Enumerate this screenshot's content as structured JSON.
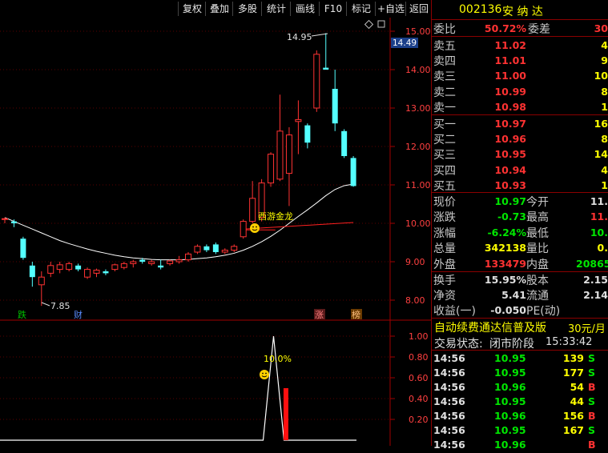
{
  "toolbar": {
    "items": [
      "复权",
      "叠加",
      "多股",
      "统计",
      "画线",
      "F10",
      "标记",
      "+自选",
      "返回"
    ]
  },
  "chart": {
    "price_ticks": [
      "15.00",
      "14.00",
      "13.00",
      "12.00",
      "11.00",
      "10.00",
      "9.00",
      "8.00"
    ],
    "current_price_tag": "14.49",
    "high_label": "14.95",
    "low_label": "7.85",
    "strategy_label": "西游金龙",
    "event_markers": [
      "跌",
      "财",
      "涨",
      "榜"
    ],
    "indicator_ticks": [
      "1.00",
      "0.80",
      "0.60",
      "0.40",
      "0.20"
    ],
    "indicator_label": "10.0%",
    "icons": [
      "smiley-icon",
      "diamond-icon"
    ]
  },
  "chart_data": {
    "type": "candlestick",
    "title": "",
    "ylim": [
      7.7,
      15.3
    ],
    "candles": [
      {
        "o": 10.1,
        "h": 10.15,
        "l": 10.0,
        "c": 10.12
      },
      {
        "o": 10.05,
        "h": 10.1,
        "l": 9.9,
        "c": 10.0
      },
      {
        "o": 9.6,
        "h": 9.65,
        "l": 9.05,
        "c": 9.1
      },
      {
        "o": 8.9,
        "h": 9.0,
        "l": 8.35,
        "c": 8.6
      },
      {
        "o": 8.4,
        "h": 8.75,
        "l": 7.85,
        "c": 8.6
      },
      {
        "o": 8.7,
        "h": 9.0,
        "l": 8.6,
        "c": 8.9
      },
      {
        "o": 8.8,
        "h": 9.0,
        "l": 8.7,
        "c": 8.92
      },
      {
        "o": 8.8,
        "h": 9.0,
        "l": 8.75,
        "c": 8.95
      },
      {
        "o": 8.9,
        "h": 8.95,
        "l": 8.75,
        "c": 8.8
      },
      {
        "o": 8.6,
        "h": 8.85,
        "l": 8.55,
        "c": 8.8
      },
      {
        "o": 8.7,
        "h": 8.82,
        "l": 8.6,
        "c": 8.78
      },
      {
        "o": 8.75,
        "h": 8.8,
        "l": 8.65,
        "c": 8.7
      },
      {
        "o": 8.8,
        "h": 8.95,
        "l": 8.75,
        "c": 8.92
      },
      {
        "o": 8.85,
        "h": 9.0,
        "l": 8.8,
        "c": 8.95
      },
      {
        "o": 8.95,
        "h": 9.05,
        "l": 8.85,
        "c": 9.0
      },
      {
        "o": 9.05,
        "h": 9.1,
        "l": 8.95,
        "c": 9.0
      },
      {
        "o": 8.95,
        "h": 9.05,
        "l": 8.9,
        "c": 9.0
      },
      {
        "o": 8.9,
        "h": 9.05,
        "l": 8.8,
        "c": 8.85
      },
      {
        "o": 8.95,
        "h": 9.05,
        "l": 8.9,
        "c": 9.02
      },
      {
        "o": 9.0,
        "h": 9.15,
        "l": 8.95,
        "c": 9.05
      },
      {
        "o": 9.05,
        "h": 9.25,
        "l": 9.0,
        "c": 9.2
      },
      {
        "o": 9.25,
        "h": 9.45,
        "l": 9.2,
        "c": 9.4
      },
      {
        "o": 9.4,
        "h": 9.45,
        "l": 9.25,
        "c": 9.3
      },
      {
        "o": 9.45,
        "h": 9.5,
        "l": 9.2,
        "c": 9.25
      },
      {
        "o": 9.25,
        "h": 9.35,
        "l": 9.2,
        "c": 9.3
      },
      {
        "o": 9.3,
        "h": 9.45,
        "l": 9.25,
        "c": 9.4
      },
      {
        "o": 9.65,
        "h": 10.1,
        "l": 9.6,
        "c": 10.05
      },
      {
        "o": 10.05,
        "h": 11.1,
        "l": 10.0,
        "c": 10.65
      },
      {
        "o": 10.15,
        "h": 11.15,
        "l": 10.05,
        "c": 11.05
      },
      {
        "o": 11.05,
        "h": 11.85,
        "l": 10.95,
        "c": 11.8
      },
      {
        "o": 11.15,
        "h": 13.35,
        "l": 11.1,
        "c": 12.4
      },
      {
        "o": 11.3,
        "h": 12.5,
        "l": 10.45,
        "c": 12.3
      },
      {
        "o": 12.65,
        "h": 13.2,
        "l": 11.8,
        "c": 12.7
      },
      {
        "o": 12.55,
        "h": 12.6,
        "l": 11.95,
        "c": 12.1
      },
      {
        "o": 13.0,
        "h": 14.5,
        "l": 12.9,
        "c": 14.4
      },
      {
        "o": 14.05,
        "h": 14.95,
        "l": 14.0,
        "c": 14.0
      },
      {
        "o": 13.5,
        "h": 14.0,
        "l": 12.4,
        "c": 12.6
      },
      {
        "o": 12.4,
        "h": 12.45,
        "l": 11.7,
        "c": 11.75
      },
      {
        "o": 11.7,
        "h": 11.75,
        "l": 10.95,
        "c": 10.97
      }
    ],
    "ma": [
      10.15,
      10.05,
      9.95,
      9.85,
      9.75,
      9.65,
      9.55,
      9.47,
      9.4,
      9.33,
      9.27,
      9.22,
      9.17,
      9.13,
      9.1,
      9.08,
      9.06,
      9.05,
      9.05,
      9.05,
      9.06,
      9.08,
      9.1,
      9.13,
      9.17,
      9.22,
      9.3,
      9.4,
      9.52,
      9.66,
      9.82,
      10.0,
      10.18,
      10.35,
      10.53,
      10.72,
      10.88,
      10.98,
      11.02
    ],
    "ref_line": [
      9.85,
      10.02
    ],
    "indicator_ylim": [
      0,
      1.1
    ],
    "indicator_spike": {
      "index": 30,
      "value": 1.0
    },
    "indicator_bar": {
      "index": 31,
      "value": 0.5
    }
  },
  "quote": {
    "code": "002136",
    "name": "安 纳 达",
    "weibi_label": "委比",
    "weibi_value": "50.72%",
    "weicha_label": "委差",
    "weicha_value": "30",
    "sell": [
      {
        "label": "卖五",
        "price": "11.02",
        "vol": "4"
      },
      {
        "label": "卖四",
        "price": "11.01",
        "vol": "9"
      },
      {
        "label": "卖三",
        "price": "11.00",
        "vol": "10"
      },
      {
        "label": "卖二",
        "price": "10.99",
        "vol": "8"
      },
      {
        "label": "卖一",
        "price": "10.98",
        "vol": "1"
      }
    ],
    "buy": [
      {
        "label": "买一",
        "price": "10.97",
        "vol": "16"
      },
      {
        "label": "买二",
        "price": "10.96",
        "vol": "8"
      },
      {
        "label": "买三",
        "price": "10.95",
        "vol": "14"
      },
      {
        "label": "买四",
        "price": "10.94",
        "vol": "4"
      },
      {
        "label": "买五",
        "price": "10.93",
        "vol": "1"
      }
    ],
    "stats": [
      {
        "l1": "现价",
        "v1": "10.97",
        "c1": "green",
        "l2": "今开",
        "v2": "11.",
        "c2": "white"
      },
      {
        "l1": "涨跌",
        "v1": "-0.73",
        "c1": "green",
        "l2": "最高",
        "v2": "11.",
        "c2": "red"
      },
      {
        "l1": "涨幅",
        "v1": "-6.24%",
        "c1": "green",
        "l2": "最低",
        "v2": "10.",
        "c2": "green"
      },
      {
        "l1": "总量",
        "v1": "342138",
        "c1": "yellow",
        "l2": "量比",
        "v2": "0.",
        "c2": "yellow"
      },
      {
        "l1": "外盘",
        "v1": "133479",
        "c1": "red",
        "l2": "内盘",
        "v2": "20865",
        "c2": "green"
      }
    ],
    "stats2": [
      {
        "l1": "换手",
        "v1": "15.95%",
        "c1": "white",
        "l2": "股本",
        "v2": "2.15",
        "c2": "white"
      },
      {
        "l1": "净资",
        "v1": "5.41",
        "c1": "white",
        "l2": "流通",
        "v2": "2.14",
        "c2": "white"
      },
      {
        "l1": "收益(一)",
        "v1": "-0.050",
        "c1": "white",
        "l2": "PE(动)",
        "v2": "",
        "c2": "white"
      }
    ],
    "ad_text": "自动续费通达信普及版",
    "ad_price": "30元/月",
    "status_label": "交易状态:",
    "status_value": "闭市阶段",
    "status_time": "15:33:42",
    "ticks": [
      {
        "time": "14:56",
        "price": "10.95",
        "vol": "139",
        "side": "S"
      },
      {
        "time": "14:56",
        "price": "10.95",
        "vol": "177",
        "side": "S"
      },
      {
        "time": "14:56",
        "price": "10.96",
        "vol": "54",
        "side": "B"
      },
      {
        "time": "14:56",
        "price": "10.95",
        "vol": "44",
        "side": "S"
      },
      {
        "time": "14:56",
        "price": "10.96",
        "vol": "156",
        "side": "B"
      },
      {
        "time": "14:56",
        "price": "10.95",
        "vol": "167",
        "side": "S"
      },
      {
        "time": "14:56",
        "price": "10.96",
        "vol": "",
        "side": "B"
      }
    ]
  }
}
